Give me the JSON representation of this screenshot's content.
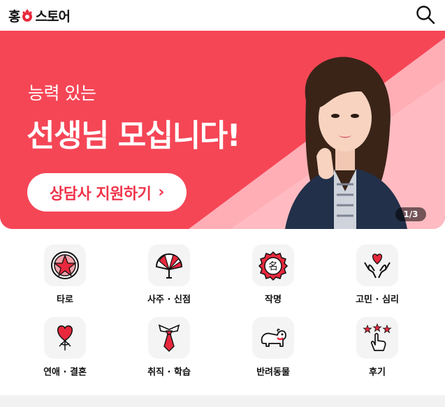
{
  "header": {
    "logo_text_left": "홍",
    "logo_text_right": "스토어",
    "search_icon": "search-icon"
  },
  "banner": {
    "subtitle": "능력 있는",
    "title": "선생님 모십니다!",
    "cta_label": "상담사 지원하기",
    "cta_chevron": "›",
    "counter": "1/3",
    "colors": {
      "main": "#f54656",
      "accent": "#ffb3b9",
      "cta_text": "#f0344b"
    }
  },
  "categories": [
    {
      "label": "타로",
      "icon": "pentagram-icon"
    },
    {
      "label": "사주 · 신점",
      "icon": "fan-icon"
    },
    {
      "label": "작명",
      "icon": "name-seal-icon"
    },
    {
      "label": "고민 · 심리",
      "icon": "heart-hands-icon"
    },
    {
      "label": "연애 · 결혼",
      "icon": "heart-balloon-icon"
    },
    {
      "label": "취직 · 학습",
      "icon": "necktie-icon"
    },
    {
      "label": "반려동물",
      "icon": "dog-icon"
    },
    {
      "label": "후기",
      "icon": "stars-hand-icon"
    }
  ]
}
